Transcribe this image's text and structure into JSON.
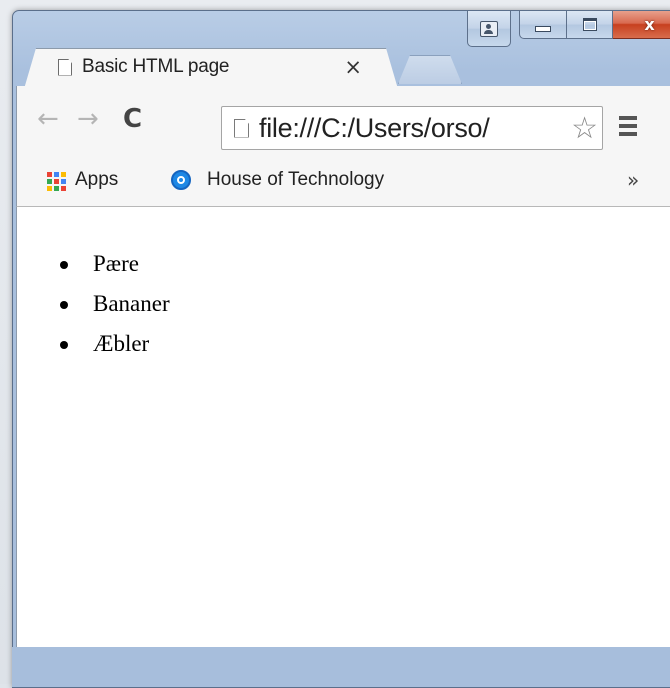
{
  "window": {
    "tab": {
      "title": "Basic HTML page",
      "close_glyph": "×",
      "icon": "document-icon"
    },
    "caption": {
      "close_glyph": "x"
    }
  },
  "toolbar": {
    "back_glyph": "←",
    "forward_glyph": "→",
    "reload_glyph": "C",
    "url": "file:///C:/Users/orso/",
    "star_glyph": "☆"
  },
  "bookmarks": {
    "apps_label": "Apps",
    "items": [
      {
        "label": "House of Technology",
        "icon": "site-favicon"
      }
    ],
    "overflow_glyph": "»"
  },
  "page": {
    "list": [
      "Pære",
      "Bananer",
      "Æbler"
    ]
  },
  "colors": {
    "frame": "#a7bedc",
    "close_button": "#c7401f",
    "favicon": "#1e88e5"
  }
}
